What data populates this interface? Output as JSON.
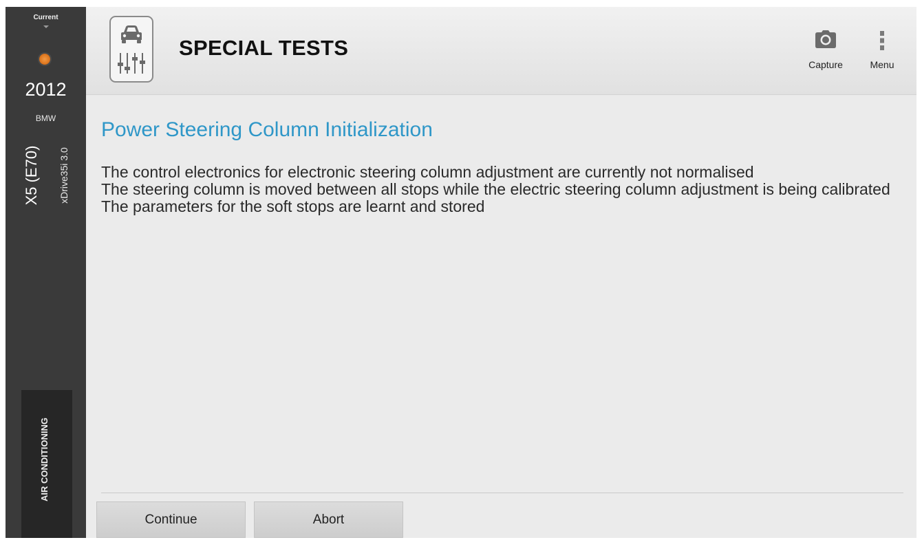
{
  "sidebar": {
    "current_label": "Current",
    "year": "2012",
    "make": "BMW",
    "model": "X5 (E70)",
    "variant": "xDrive35i 3.0",
    "status_dot_color": "#e07a22",
    "module_tab": "AIR CONDITIONING"
  },
  "header": {
    "title": "SPECIAL TESTS",
    "icon": "car-adjust-sliders-icon",
    "capture_label": "Capture",
    "capture_icon": "camera-icon",
    "menu_label": "Menu",
    "menu_icon": "more-vertical-icon"
  },
  "main": {
    "test_title": "Power Steering Column Initialization",
    "description": [
      "The control electronics for electronic steering column adjustment are currently not normalised",
      "The steering column is moved between all stops while the electric steering column adjustment is being calibrated",
      "The parameters for the soft stops are learnt and stored"
    ],
    "title_color": "#2f97c8"
  },
  "actions": {
    "continue_label": "Continue",
    "abort_label": "Abort"
  }
}
